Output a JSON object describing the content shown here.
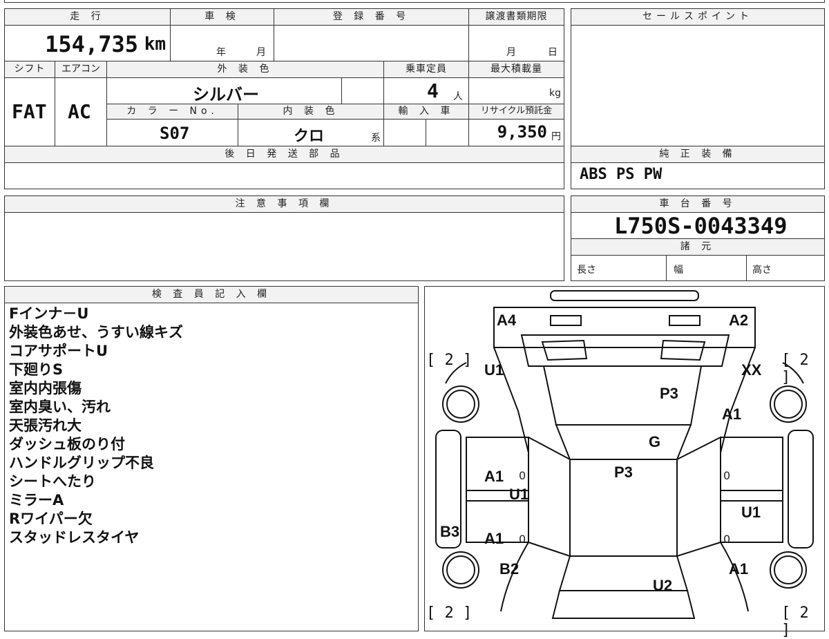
{
  "vehicle": {
    "mileage_label": "走 行",
    "mileage_value": "154,735",
    "mileage_unit": "km",
    "inspection_label": "車 検",
    "inspection_year": "年",
    "inspection_month": "月",
    "registration_label": "登 録 番 号",
    "transfer_label": "譲渡書類期限",
    "transfer_month": "月",
    "transfer_day": "日",
    "shift_label": "シフト",
    "shift_value": "FAT",
    "aircon_label": "エアコン",
    "aircon_value": "AC",
    "exterior_label": "外 装 色",
    "exterior_value": "シルバー",
    "capacity_label": "乗車定員",
    "capacity_value": "4",
    "capacity_unit": "人",
    "maxload_label": "最大積載量",
    "maxload_unit": "kg",
    "color_no_label": "カ ラ ー No.",
    "color_no_value": "S07",
    "interior_label": "内 装 色",
    "interior_value": "クロ",
    "interior_suffix": "系",
    "import_label": "輸 入 車",
    "recycle_label": "リサイクル預託金",
    "recycle_value": "9,350",
    "recycle_unit": "円",
    "sales_point_label": "セールスポイント",
    "later_parts_label": "後 日 発 送 部 品",
    "genuine_label": "純 正 装 備",
    "genuine_value": "ABS PS PW",
    "notes_label": "注 意 事 項 欄",
    "chassis_label": "車 台 番 号",
    "chassis_value": "L750S-0043349",
    "spec_label": "諸 元",
    "length_label": "長さ",
    "width_label": "幅",
    "height_label": "高さ"
  },
  "inspector": {
    "label": "検 査 員 記 入 欄",
    "lines": [
      "Fインナ－U",
      "外装色あせ、うすい線キズ",
      "コアサポートU",
      "下廻りS",
      "室内内張傷",
      "室内臭い、汚れ",
      "天張汚れ大",
      "ダッシュ板のり付",
      "ハンドルグリップ不良",
      "シートへたり",
      "ミラーA",
      "Rワイパー欠",
      "スタッドレスタイヤ"
    ]
  },
  "diagram": {
    "labels": {
      "a4": "A4",
      "a2": "A2",
      "u1_tl": "U1",
      "xx": "XX",
      "p3_top": "P3",
      "a1_rt": "A1",
      "g": "G",
      "a1_l1": "A1",
      "u1_mid": "U1",
      "p3_mid": "P3",
      "u1_r": "U1",
      "b3": "B3",
      "a1_l2": "A1",
      "b2": "B2",
      "u2": "U2",
      "a1_rb": "A1",
      "zero1": "0",
      "zero2": "0",
      "zero3": "0",
      "zero4": "0"
    },
    "brackets": {
      "tl": "[ 2 ]",
      "tr": "[ 2 ]",
      "bl": "[ 2 ]",
      "br": "[ 2 ]"
    }
  }
}
